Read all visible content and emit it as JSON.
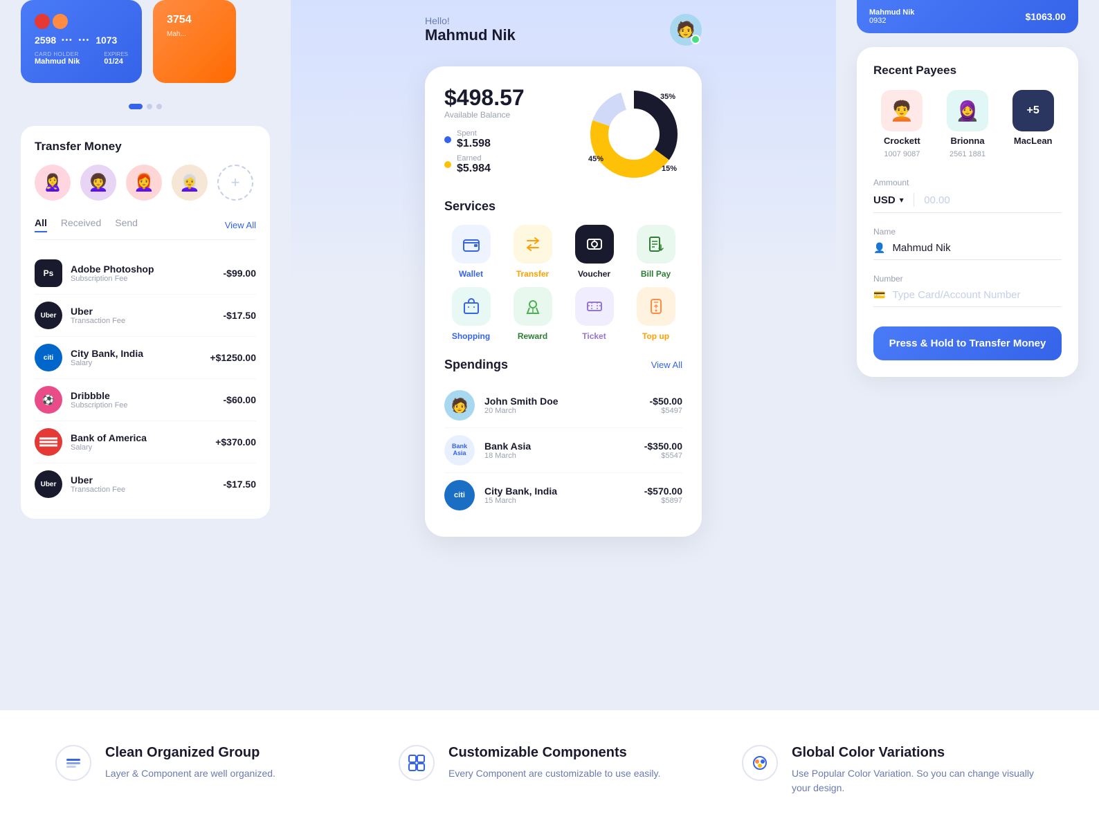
{
  "header": {
    "greeting": "Hello!",
    "name": "Mahmud Nik"
  },
  "left_panel": {
    "card1": {
      "number1": "2598",
      "dots1": "•••",
      "dots2": "•••",
      "number2": "1073",
      "holder_label": "CARD HOLDER",
      "holder_name": "Mahmud Nik",
      "expiry_label": "EXPIRES",
      "expiry_val": "01/24"
    },
    "card2": {
      "number": "3754",
      "name": "Mah..."
    },
    "transfer_section": {
      "title": "Transfer Money",
      "add_label": "+",
      "tabs": [
        "All",
        "Received",
        "Send"
      ],
      "active_tab": "All",
      "view_all": "View All",
      "transactions": [
        {
          "name": "Adobe Photoshop",
          "sub": "Subscription Fee",
          "amount": "-$99.00",
          "type": "negative",
          "icon": "Ps"
        },
        {
          "name": "Uber",
          "sub": "Transaction Fee",
          "amount": "-$17.50",
          "type": "negative",
          "icon": "Uber"
        },
        {
          "name": "City Bank, India",
          "sub": "Salary",
          "amount": "+$1250.00",
          "type": "positive",
          "icon": "citi"
        },
        {
          "name": "Dribbble",
          "sub": "Subscription Fee",
          "amount": "-$60.00",
          "type": "negative",
          "icon": "●"
        },
        {
          "name": "Bank of America",
          "sub": "Salary",
          "amount": "+$370.00",
          "type": "positive",
          "icon": "BOA"
        },
        {
          "name": "Uber",
          "sub": "Transaction Fee",
          "amount": "-$17.50",
          "type": "negative",
          "icon": "Uber"
        }
      ]
    }
  },
  "middle_panel": {
    "balance": {
      "amount": "$498.57",
      "label": "Available Balance",
      "spent_label": "Spent",
      "spent_amount": "$1.598",
      "earned_label": "Earned",
      "earned_amount": "$5.984"
    },
    "chart": {
      "segments": [
        {
          "label": "35%",
          "value": 35,
          "color": "#1a1a2e"
        },
        {
          "label": "45%",
          "value": 45,
          "color": "#FFC107"
        },
        {
          "label": "15%",
          "value": 15,
          "color": "#e0e8ff"
        }
      ]
    },
    "services": {
      "title": "Services",
      "items": [
        {
          "label": "Wallet",
          "style": "light-blue",
          "icon_color": "blue"
        },
        {
          "label": "Transfer",
          "style": "light-yellow",
          "icon_color": "yellow"
        },
        {
          "label": "Voucher",
          "style": "dark-blue",
          "icon_color": "white"
        },
        {
          "label": "Bill Pay",
          "style": "light-green",
          "icon_color": "green"
        },
        {
          "label": "Shopping",
          "style": "light-teal",
          "icon_color": "blue"
        },
        {
          "label": "Reward",
          "style": "light-green2",
          "icon_color": "green"
        },
        {
          "label": "Ticket",
          "style": "light-purple",
          "icon_color": "blue"
        },
        {
          "label": "Top up",
          "style": "light-orange",
          "icon_color": "yellow"
        }
      ]
    },
    "spendings": {
      "title": "Spendings",
      "view_all": "View All",
      "items": [
        {
          "name": "John Smith Doe",
          "date": "20 March",
          "amount": "-$50.00",
          "sub": "$5497",
          "icon": "👤"
        },
        {
          "name": "Bank Asia",
          "date": "18 March",
          "amount": "-$350.00",
          "sub": "$5547",
          "icon": "🏦"
        },
        {
          "name": "City Bank, India",
          "date": "15 March",
          "amount": "-$570.00",
          "sub": "$5897",
          "icon": "🏛"
        }
      ]
    }
  },
  "right_panel": {
    "top_strip": {
      "name": "Mahmud Nik",
      "number": "0932",
      "amount": "$1063.00"
    },
    "recent_payees": {
      "title": "Recent Payees",
      "payees": [
        {
          "name": "Crockett",
          "number": "1007 9087",
          "style": "crockett"
        },
        {
          "name": "Brionna",
          "number": "2561 1881",
          "style": "brionna"
        },
        {
          "name": "+5",
          "sub": "MacLean",
          "style": "maclean"
        }
      ]
    },
    "form": {
      "amount_label": "Ammount",
      "currency": "USD",
      "amount_placeholder": "00.00",
      "name_label": "Name",
      "name_value": "Mahmud Nik",
      "number_label": "Number",
      "number_placeholder": "Type Card/Account Number"
    },
    "button_label": "Press & Hold to Transfer Money"
  },
  "bottom_features": [
    {
      "title": "Clean Organized Group",
      "desc": "Layer & Component are well organized.",
      "icon": "🗂"
    },
    {
      "title": "Customizable Components",
      "desc": "Every Component are customizable to use easily.",
      "icon": "⚙"
    },
    {
      "title": "Global Color Variations",
      "desc": "Use Popular Color Variation. So you can change visually your design.",
      "icon": "🎨"
    }
  ]
}
